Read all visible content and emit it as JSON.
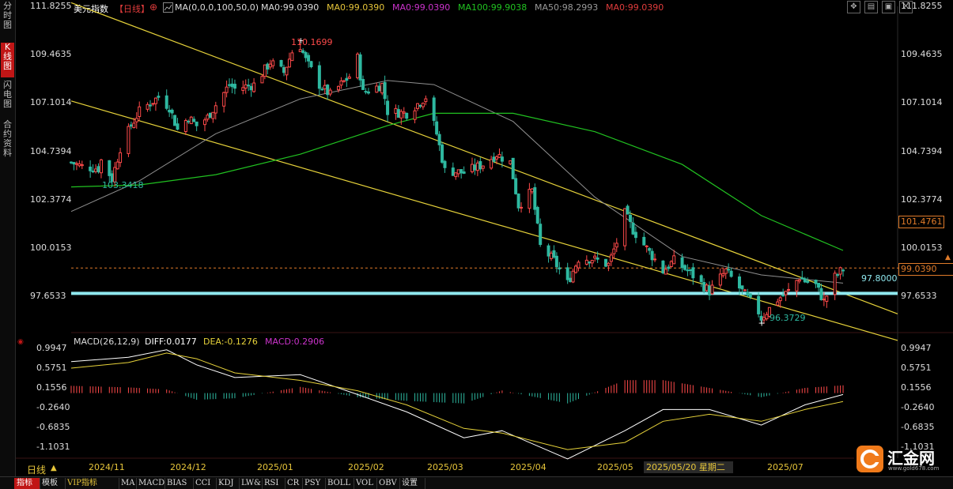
{
  "sidebar": {
    "items": [
      "分时图",
      "K线图",
      "闪电图",
      "合约资料"
    ]
  },
  "header": {
    "title": "美元指数",
    "period": "【日线】",
    "period_icon": "plus-circle-icon",
    "ma_icon": "ma-settings-icon",
    "ma_params": "MA(0,0,0,100,50,0)",
    "ma_items": [
      {
        "text": "MA0:99.0390",
        "color": "#dddddd"
      },
      {
        "text": "MA0:99.0390",
        "color": "#e6c53a"
      },
      {
        "text": "MA0:99.0390",
        "color": "#cc33cc"
      },
      {
        "text": "MA100:99.9038",
        "color": "#21c221"
      },
      {
        "text": "MA50:98.2993",
        "color": "#9a9a9a"
      },
      {
        "text": "MA0:99.0390",
        "color": "#e03c3c"
      }
    ]
  },
  "window_controls": [
    "minimize-icon",
    "restore-icon",
    "maximize-icon",
    "close-icon"
  ],
  "colors": {
    "up": "#ff4a4a",
    "down": "#2eb8a0",
    "ma100": "#21c221",
    "ma50": "#8f8f8f",
    "trend": "#e6d23a",
    "support": "#8fe8ef",
    "diff": "#ffffff",
    "dea": "#e6d23a"
  },
  "price_axis": {
    "ticks": [
      "111.8255",
      "109.4635",
      "107.1014",
      "104.7394",
      "102.3774",
      "100.0153",
      "97.6533"
    ],
    "current_price": "99.0390",
    "level_101": "101.4761",
    "support_label": "97.8000"
  },
  "annotations": {
    "high": "110.1699",
    "low_early": "103.3418",
    "low_recent": "96.3729"
  },
  "macd": {
    "params": "MACD(26,12,9)",
    "diff": "DIFF:0.0177",
    "dea": "DEA:-0.1276",
    "macd": "MACD:0.2906",
    "ticks": [
      "0.9947",
      "0.5751",
      "0.1556",
      "-0.2640",
      "-0.6835",
      "-1.1031"
    ]
  },
  "x_axis": {
    "period_label": "日线",
    "labels": [
      "2024/11",
      "2024/12",
      "2025/01",
      "2025/02",
      "2025/03",
      "2025/04",
      "2025/05",
      "2025/07"
    ],
    "cursor_date": "2025/05/20 星期二"
  },
  "bottom_tabs": [
    "指标",
    "模板",
    "VIP指标",
    "MA",
    "MACD",
    "BIAS",
    "CCI",
    "KDJ",
    "LW&",
    "RSI",
    "CR",
    "PSY",
    "BOLL",
    "VOL",
    "OBV",
    "设置"
  ],
  "logo": {
    "text": "汇金网",
    "sub": "www.gold678.com"
  },
  "chart_data": {
    "type": "candlestick",
    "title": "美元指数 日线",
    "ylim": [
      96.0,
      111.8255
    ],
    "series": [
      {
        "name": "MA100",
        "value_last": 99.9038
      },
      {
        "name": "MA50",
        "value_last": 98.2993
      }
    ],
    "close_path": [
      {
        "x": "2024-10-21",
        "y": 104.2
      },
      {
        "x": "2024-10-25",
        "y": 104.0
      },
      {
        "x": "2024-10-31",
        "y": 103.9
      },
      {
        "x": "2024-11-01",
        "y": 104.3
      },
      {
        "x": "2024-11-05",
        "y": 103.4
      },
      {
        "x": "2024-11-08",
        "y": 104.9
      },
      {
        "x": "2024-11-12",
        "y": 106.0
      },
      {
        "x": "2024-11-15",
        "y": 106.7
      },
      {
        "x": "2024-11-22",
        "y": 107.4
      },
      {
        "x": "2024-11-26",
        "y": 106.9
      },
      {
        "x": "2024-11-29",
        "y": 105.8
      },
      {
        "x": "2024-12-03",
        "y": 106.4
      },
      {
        "x": "2024-12-06",
        "y": 106.0
      },
      {
        "x": "2024-12-10",
        "y": 106.4
      },
      {
        "x": "2024-12-13",
        "y": 107.0
      },
      {
        "x": "2024-12-18",
        "y": 108.0
      },
      {
        "x": "2024-12-20",
        "y": 107.8
      },
      {
        "x": "2024-12-27",
        "y": 108.0
      },
      {
        "x": "2025-01-02",
        "y": 109.1
      },
      {
        "x": "2025-01-07",
        "y": 108.6
      },
      {
        "x": "2025-01-10",
        "y": 109.6
      },
      {
        "x": "2025-01-13",
        "y": 109.9
      },
      {
        "x": "2025-01-15",
        "y": 109.2
      },
      {
        "x": "2025-01-20",
        "y": 108.0
      },
      {
        "x": "2025-01-24",
        "y": 107.5
      },
      {
        "x": "2025-01-31",
        "y": 108.4
      },
      {
        "x": "2025-02-03",
        "y": 109.3
      },
      {
        "x": "2025-02-05",
        "y": 107.6
      },
      {
        "x": "2025-02-12",
        "y": 108.0
      },
      {
        "x": "2025-02-14",
        "y": 106.7
      },
      {
        "x": "2025-02-21",
        "y": 106.6
      },
      {
        "x": "2025-02-28",
        "y": 107.4
      },
      {
        "x": "2025-03-04",
        "y": 105.6
      },
      {
        "x": "2025-03-07",
        "y": 103.8
      },
      {
        "x": "2025-03-14",
        "y": 103.7
      },
      {
        "x": "2025-03-21",
        "y": 104.1
      },
      {
        "x": "2025-03-26",
        "y": 104.6
      },
      {
        "x": "2025-03-31",
        "y": 104.2
      },
      {
        "x": "2025-04-03",
        "y": 102.1
      },
      {
        "x": "2025-04-08",
        "y": 102.8
      },
      {
        "x": "2025-04-11",
        "y": 100.1
      },
      {
        "x": "2025-04-16",
        "y": 99.4
      },
      {
        "x": "2025-04-21",
        "y": 98.3
      },
      {
        "x": "2025-04-25",
        "y": 99.5
      },
      {
        "x": "2025-04-30",
        "y": 99.5
      },
      {
        "x": "2025-05-06",
        "y": 99.2
      },
      {
        "x": "2025-05-09",
        "y": 100.3
      },
      {
        "x": "2025-05-12",
        "y": 101.7
      },
      {
        "x": "2025-05-15",
        "y": 100.9
      },
      {
        "x": "2025-05-20",
        "y": 100.0
      },
      {
        "x": "2025-05-26",
        "y": 98.9
      },
      {
        "x": "2025-05-30",
        "y": 99.4
      },
      {
        "x": "2025-06-05",
        "y": 98.8
      },
      {
        "x": "2025-06-12",
        "y": 97.9
      },
      {
        "x": "2025-06-18",
        "y": 98.9
      },
      {
        "x": "2025-06-24",
        "y": 97.9
      },
      {
        "x": "2025-06-30",
        "y": 96.9
      },
      {
        "x": "2025-07-01",
        "y": 96.6
      },
      {
        "x": "2025-07-07",
        "y": 97.5
      },
      {
        "x": "2025-07-11",
        "y": 97.9
      },
      {
        "x": "2025-07-15",
        "y": 98.6
      },
      {
        "x": "2025-07-17",
        "y": 98.4
      },
      {
        "x": "2025-07-21",
        "y": 98.2
      },
      {
        "x": "2025-07-24",
        "y": 97.4
      },
      {
        "x": "2025-07-28",
        "y": 98.6
      },
      {
        "x": "2025-07-31",
        "y": 99.0
      }
    ],
    "ma100_path": [
      {
        "x": "2024-10-21",
        "y": 103.0
      },
      {
        "x": "2024-11-15",
        "y": 103.1
      },
      {
        "x": "2024-12-13",
        "y": 103.6
      },
      {
        "x": "2025-01-13",
        "y": 104.6
      },
      {
        "x": "2025-02-14",
        "y": 106.0
      },
      {
        "x": "2025-03-03",
        "y": 106.6
      },
      {
        "x": "2025-04-01",
        "y": 106.6
      },
      {
        "x": "2025-05-01",
        "y": 105.7
      },
      {
        "x": "2025-06-02",
        "y": 104.1
      },
      {
        "x": "2025-07-01",
        "y": 101.6
      },
      {
        "x": "2025-07-31",
        "y": 99.9
      }
    ],
    "ma50_path": [
      {
        "x": "2024-10-21",
        "y": 101.8
      },
      {
        "x": "2024-11-15",
        "y": 103.3
      },
      {
        "x": "2024-12-13",
        "y": 105.6
      },
      {
        "x": "2025-01-13",
        "y": 107.3
      },
      {
        "x": "2025-02-14",
        "y": 108.2
      },
      {
        "x": "2025-03-03",
        "y": 108.0
      },
      {
        "x": "2025-04-01",
        "y": 106.2
      },
      {
        "x": "2025-05-01",
        "y": 102.5
      },
      {
        "x": "2025-06-02",
        "y": 99.6
      },
      {
        "x": "2025-07-01",
        "y": 98.7
      },
      {
        "x": "2025-07-31",
        "y": 98.3
      }
    ],
    "trendlines": [
      {
        "from": {
          "x": "2024-10-21",
          "y": 112.0
        },
        "to": {
          "x": "2025-08-20",
          "y": 96.8
        }
      },
      {
        "from": {
          "x": "2024-10-21",
          "y": 107.2
        },
        "to": {
          "x": "2025-08-20",
          "y": 95.5
        }
      }
    ],
    "support_level": 97.8,
    "macd_ylim": [
      -1.3,
      1.05
    ],
    "macd_diff_path": [
      {
        "x": "2024-10-21",
        "y": 0.72
      },
      {
        "x": "2024-11-11",
        "y": 0.81
      },
      {
        "x": "2024-11-25",
        "y": 0.97
      },
      {
        "x": "2024-12-06",
        "y": 0.65
      },
      {
        "x": "2024-12-20",
        "y": 0.38
      },
      {
        "x": "2025-01-13",
        "y": 0.44
      },
      {
        "x": "2025-02-03",
        "y": 0.02
      },
      {
        "x": "2025-02-21",
        "y": -0.35
      },
      {
        "x": "2025-03-14",
        "y": -0.9
      },
      {
        "x": "2025-03-28",
        "y": -0.75
      },
      {
        "x": "2025-04-21",
        "y": -1.35
      },
      {
        "x": "2025-05-12",
        "y": -0.75
      },
      {
        "x": "2025-05-26",
        "y": -0.3
      },
      {
        "x": "2025-06-12",
        "y": -0.3
      },
      {
        "x": "2025-07-01",
        "y": -0.63
      },
      {
        "x": "2025-07-17",
        "y": -0.2
      },
      {
        "x": "2025-07-31",
        "y": 0.02
      }
    ],
    "macd_dea_path": [
      {
        "x": "2024-10-21",
        "y": 0.58
      },
      {
        "x": "2024-11-11",
        "y": 0.7
      },
      {
        "x": "2024-11-25",
        "y": 0.9
      },
      {
        "x": "2024-12-06",
        "y": 0.78
      },
      {
        "x": "2024-12-20",
        "y": 0.48
      },
      {
        "x": "2025-01-13",
        "y": 0.32
      },
      {
        "x": "2025-02-03",
        "y": 0.1
      },
      {
        "x": "2025-02-21",
        "y": -0.2
      },
      {
        "x": "2025-03-14",
        "y": -0.7
      },
      {
        "x": "2025-03-28",
        "y": -0.8
      },
      {
        "x": "2025-04-21",
        "y": -1.15
      },
      {
        "x": "2025-05-12",
        "y": -1.0
      },
      {
        "x": "2025-05-26",
        "y": -0.55
      },
      {
        "x": "2025-06-12",
        "y": -0.4
      },
      {
        "x": "2025-07-01",
        "y": -0.55
      },
      {
        "x": "2025-07-17",
        "y": -0.3
      },
      {
        "x": "2025-07-31",
        "y": -0.13
      }
    ]
  }
}
